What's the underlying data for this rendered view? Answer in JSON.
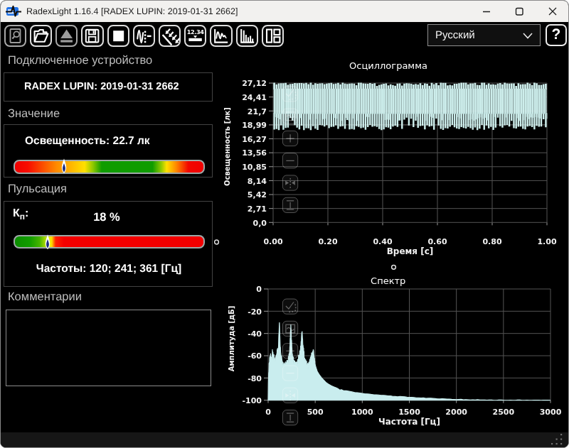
{
  "window": {
    "title": "RadexLight 1.16.4 [RADEX LUPIN: 2019-01-31 2662]"
  },
  "toolbar": {
    "buttons": [
      {
        "name": "report-preview",
        "icon": "document-magnifier-icon",
        "state": "dim"
      },
      {
        "name": "open-file",
        "icon": "open-folder-icon",
        "state": "normal"
      },
      {
        "name": "eject-device",
        "icon": "eject-icon",
        "state": "dim"
      },
      {
        "name": "save-file",
        "icon": "floppy-disk-icon",
        "state": "normal"
      },
      {
        "name": "stop-measurement",
        "icon": "stop-square-icon",
        "state": "normal"
      },
      {
        "name": "single-measurement",
        "icon": "pulse-trace-icon",
        "state": "normal"
      },
      {
        "name": "illuminance-mode",
        "icon": "light-rays-icon",
        "state": "normal"
      },
      {
        "name": "numeric-display",
        "icon": "numeric-display-icon",
        "state": "normal",
        "text": "12.34"
      },
      {
        "name": "show-oscillogram",
        "icon": "oscillogram-icon",
        "state": "normal"
      },
      {
        "name": "show-spectrum",
        "icon": "spectrum-bars-icon",
        "state": "normal"
      },
      {
        "name": "layout-panels",
        "icon": "layout-panels-icon",
        "state": "normal"
      }
    ],
    "language": {
      "value": "Русский"
    },
    "help_label": "?"
  },
  "device_panel": {
    "label": "Подключенное устройство",
    "device": "RADEX LUPIN: 2019-01-31 2662"
  },
  "value_panel": {
    "label": "Значение",
    "reading": "Освещенность: 22.7 лк",
    "bar": {
      "marker_fraction": 0.265,
      "marker_color": "#1c2a7d",
      "gradient": [
        [
          "#f00000",
          0
        ],
        [
          "#f80e00",
          7
        ],
        [
          "#ff8a00",
          22
        ],
        [
          "#ffe000",
          37
        ],
        [
          "#8cc800",
          41.5
        ],
        [
          "#0f9c00",
          46
        ],
        [
          "#0f9c00",
          73
        ],
        [
          "#8cc800",
          77.5
        ],
        [
          "#ffe000",
          80.5
        ],
        [
          "#ff8a00",
          85.5
        ],
        [
          "#f20600",
          92
        ],
        [
          "#f00000",
          100
        ]
      ]
    }
  },
  "pulsation_panel": {
    "label": "Пульсация",
    "kp_symbol": "К",
    "kp_sub": "п",
    "kp_colon": ":",
    "kp_value": "18 %",
    "frequencies": "Частоты: 120; 241; 361 [Гц]",
    "bar": {
      "marker_fraction": 0.177,
      "marker_color": "#1c2a7d",
      "gradient": [
        [
          "#0b8e00",
          0
        ],
        [
          "#129e00",
          8
        ],
        [
          "#44b400",
          13
        ],
        [
          "#a6d800",
          16
        ],
        [
          "#eef000",
          18.5
        ],
        [
          "#ffd800",
          19.6
        ],
        [
          "#ff8800",
          20.4
        ],
        [
          "#ff2000",
          21.6
        ],
        [
          "#f40000",
          26
        ],
        [
          "#f20000",
          100
        ]
      ]
    }
  },
  "comments_panel": {
    "label": "Комментарии",
    "text": ""
  },
  "chart_data": [
    {
      "id": "oscillogram",
      "type": "line",
      "title": "Осциллограмма",
      "xlabel": "Время [с]",
      "ylabel": "Освещенность [лк]",
      "xlim": [
        0,
        1
      ],
      "ylim": [
        0,
        27.12
      ],
      "x_ticks": [
        "0.00",
        "0.20",
        "0.40",
        "0.60",
        "0.80",
        "1.00"
      ],
      "y_ticks": [
        "27,12",
        "24,41",
        "21,7",
        "18,99",
        "16,27",
        "13,56",
        "10,85",
        "8,14",
        "5,42",
        "2,71",
        "0,0"
      ],
      "grid": true,
      "signal": {
        "shape": "rectified-flicker",
        "min_lux": 18.99,
        "max_lux": 27.12,
        "frequency_hz": 120,
        "duration_s": 1.0
      },
      "series_color": "#cdeeec"
    },
    {
      "id": "spectrum",
      "type": "area",
      "title": "Спектр",
      "xlabel": "Частота [Гц]",
      "ylabel": "Амплитуда [дБ]",
      "xlim": [
        0,
        3000
      ],
      "ylim": [
        -100,
        0
      ],
      "x_ticks": [
        "0",
        "500",
        "1000",
        "1500",
        "2000",
        "2500",
        "3000"
      ],
      "y_ticks": [
        "0",
        "-20",
        "-40",
        "-60",
        "-80",
        "-100"
      ],
      "grid": true,
      "peaks_hz": [
        120,
        241,
        361
      ],
      "envelope_db": [
        [
          0,
          -100
        ],
        [
          2,
          -85
        ],
        [
          5,
          -75
        ],
        [
          8,
          -70
        ],
        [
          12,
          -66
        ],
        [
          18,
          -63
        ],
        [
          24,
          -60
        ],
        [
          30,
          -63
        ],
        [
          36,
          -61
        ],
        [
          42,
          -59
        ],
        [
          48,
          -56
        ],
        [
          52,
          -57
        ],
        [
          58,
          -60
        ],
        [
          64,
          -62
        ],
        [
          72,
          -64
        ],
        [
          80,
          -62
        ],
        [
          88,
          -59
        ],
        [
          96,
          -57
        ],
        [
          104,
          -55
        ],
        [
          110,
          -50
        ],
        [
          115,
          -40
        ],
        [
          118,
          -33
        ],
        [
          120,
          -30
        ],
        [
          122,
          -34
        ],
        [
          125,
          -42
        ],
        [
          128,
          -50
        ],
        [
          132,
          -56
        ],
        [
          138,
          -60
        ],
        [
          145,
          -63
        ],
        [
          152,
          -66
        ],
        [
          160,
          -68
        ],
        [
          168,
          -66
        ],
        [
          176,
          -68
        ],
        [
          184,
          -67
        ],
        [
          192,
          -69
        ],
        [
          200,
          -67
        ],
        [
          208,
          -65
        ],
        [
          216,
          -62
        ],
        [
          224,
          -58
        ],
        [
          230,
          -52
        ],
        [
          235,
          -44
        ],
        [
          238,
          -37
        ],
        [
          241,
          -32
        ],
        [
          244,
          -38
        ],
        [
          248,
          -46
        ],
        [
          252,
          -52
        ],
        [
          258,
          -58
        ],
        [
          264,
          -62
        ],
        [
          272,
          -65
        ],
        [
          280,
          -67
        ],
        [
          290,
          -68
        ],
        [
          300,
          -69
        ],
        [
          310,
          -67
        ],
        [
          320,
          -64
        ],
        [
          330,
          -61
        ],
        [
          340,
          -56
        ],
        [
          348,
          -50
        ],
        [
          354,
          -44
        ],
        [
          358,
          -40
        ],
        [
          361,
          -38
        ],
        [
          364,
          -43
        ],
        [
          368,
          -49
        ],
        [
          374,
          -54
        ],
        [
          380,
          -58
        ],
        [
          388,
          -62
        ],
        [
          396,
          -65
        ],
        [
          406,
          -67
        ],
        [
          416,
          -69
        ],
        [
          426,
          -70
        ],
        [
          436,
          -68
        ],
        [
          446,
          -65
        ],
        [
          456,
          -62
        ],
        [
          464,
          -59
        ],
        [
          470,
          -57
        ],
        [
          475,
          -56
        ],
        [
          480,
          -55
        ],
        [
          485,
          -59
        ],
        [
          492,
          -64
        ],
        [
          500,
          -68
        ],
        [
          510,
          -71
        ],
        [
          522,
          -74
        ],
        [
          536,
          -76
        ],
        [
          552,
          -78
        ],
        [
          570,
          -80
        ],
        [
          592,
          -82
        ],
        [
          615,
          -84
        ],
        [
          640,
          -85.5
        ],
        [
          670,
          -87
        ],
        [
          700,
          -88
        ],
        [
          740,
          -89.5
        ],
        [
          780,
          -90.5
        ],
        [
          830,
          -91.5
        ],
        [
          890,
          -92.5
        ],
        [
          950,
          -93.2
        ],
        [
          1000,
          -93.8
        ],
        [
          1100,
          -94.8
        ],
        [
          1200,
          -95.6
        ],
        [
          1350,
          -96.6
        ],
        [
          1500,
          -97.3
        ],
        [
          1700,
          -98.2
        ],
        [
          1900,
          -99
        ],
        [
          2100,
          -99.5
        ],
        [
          2300,
          -99.8
        ],
        [
          2600,
          -100
        ],
        [
          3000,
          -100
        ]
      ],
      "series_color": "#c9edee"
    }
  ],
  "chart_buttons": [
    "select-region",
    "show-trace",
    "zoom-in",
    "zoom-out",
    "fit-horizontal",
    "fit-vertical"
  ],
  "colors": {
    "window_bg": "#000000",
    "titlebar_bg": "#f2f1ef",
    "grid": "#545454",
    "tick_text": "#f2f2f2",
    "waveform": "#cdeeec",
    "spectrum_fill": "#c9edee"
  }
}
